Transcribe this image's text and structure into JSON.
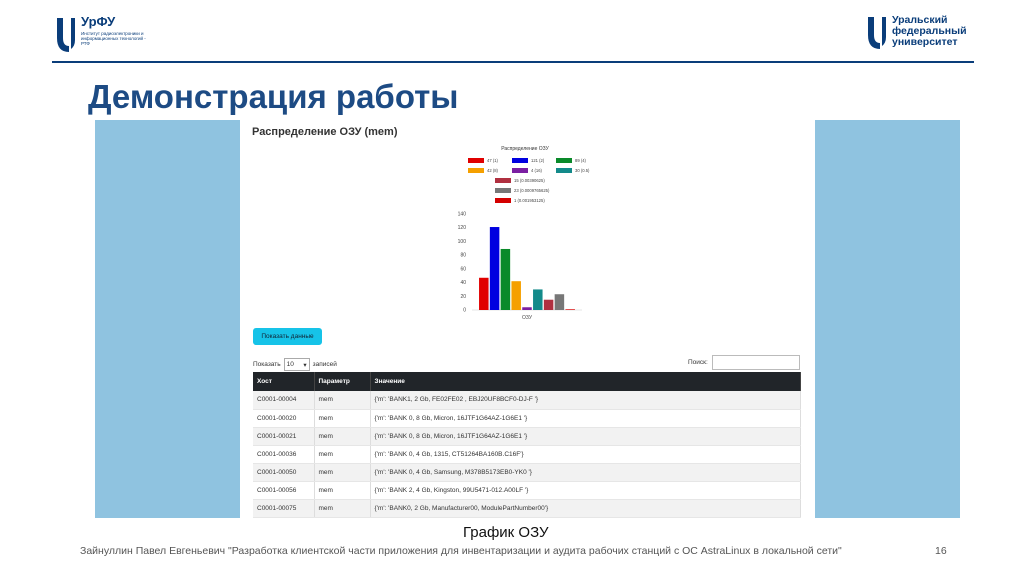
{
  "header": {
    "left_logo": {
      "brand": "УрФУ",
      "subtitle": "Институт радиоэлектроники и информационных технологий - РТФ"
    },
    "right_logo": {
      "text": "Уральский\nфедеральный\nуниверситет"
    },
    "accent_color": "#0a3d7a"
  },
  "title": "Демонстрация работы",
  "screenshot": {
    "panel_title": "Распределение ОЗУ (mem)",
    "button_label": "Показать данные",
    "show_label": "Показать",
    "entries_value": "10",
    "entries_suffix": "записей",
    "search_label": "Поиск:",
    "table": {
      "headers": [
        "Хост",
        "Параметр",
        "Значение"
      ],
      "rows": [
        [
          "C0001-00004",
          "mem",
          "{'m': 'BANK1, 2 Gb, FE02FE02 , EBJ20UF8BCF0-DJ-F '}"
        ],
        [
          "C0001-00020",
          "mem",
          "{'m': 'BANK 0, 8 Gb, Micron, 16JTF1G64AZ-1G6E1 '}"
        ],
        [
          "C0001-00021",
          "mem",
          "{'m': 'BANK 0, 8 Gb, Micron, 16JTF1G64AZ-1G6E1 '}"
        ],
        [
          "C0001-00036",
          "mem",
          "{'m': 'BANK 0, 4 Gb, 1315, CT51264BA160B.C16F'}"
        ],
        [
          "C0001-00050",
          "mem",
          "{'m': 'BANK 0, 4 Gb, Samsung, M378B5173EB0-YK0 '}"
        ],
        [
          "C0001-00056",
          "mem",
          "{'m': 'BANK 2, 4 Gb, Kingston, 99U5471-012.A00LF '}"
        ],
        [
          "C0001-00075",
          "mem",
          "{'m': 'BANK0, 2 Gb, Manufacturer00, ModulePartNumber00'}"
        ]
      ]
    }
  },
  "chart_data": {
    "type": "bar",
    "title": "Распределение ОЗУ",
    "xlabel": "ОЗУ",
    "categories": [
      "ОЗУ"
    ],
    "ylim": [
      0,
      140
    ],
    "yticks": [
      0,
      20,
      40,
      60,
      80,
      100,
      120,
      140
    ],
    "series": [
      {
        "name": "47 (1)",
        "values": [
          47
        ],
        "color": "#e00000"
      },
      {
        "name": "121 (2)",
        "values": [
          121
        ],
        "color": "#0000e0"
      },
      {
        "name": "89 (4)",
        "values": [
          89
        ],
        "color": "#0a8a2a"
      },
      {
        "name": "42 (8)",
        "values": [
          42
        ],
        "color": "#f5a000"
      },
      {
        "name": "4 (16)",
        "values": [
          4
        ],
        "color": "#7b1fa2"
      },
      {
        "name": "30 (0.5)",
        "values": [
          30
        ],
        "color": "#138a8a"
      },
      {
        "name": "15 (0.00390625)",
        "values": [
          15
        ],
        "color": "#b03040"
      },
      {
        "name": "23 (0.0009765625)",
        "values": [
          23
        ],
        "color": "#777777"
      },
      {
        "name": "1 (0.001953125)",
        "values": [
          1
        ],
        "color": "#d40000"
      }
    ]
  },
  "caption": "График ОЗУ",
  "footer": "Зайнуллин Павел Евгеньевич \"Разработка клиентской части приложения для инвентаризации и аудита рабочих станций с ОС AstraLinux в локальной сети\"",
  "page_number": "16"
}
